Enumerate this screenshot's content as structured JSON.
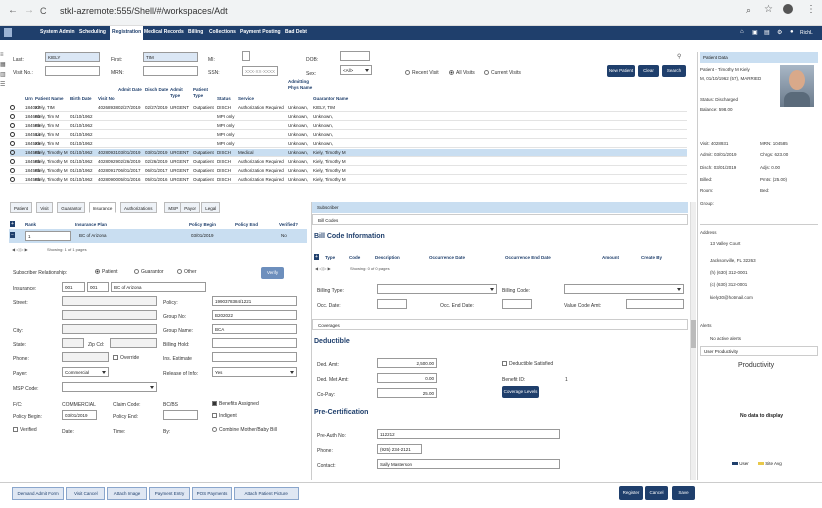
{
  "browser": {
    "url": "stkl-azremote:555/Shell/#/workspaces/Adt",
    "back": "←",
    "forward": "→",
    "reload": "C"
  },
  "nav": {
    "items": [
      "System Admin",
      "Scheduling",
      "Registration",
      "Medical Records",
      "Billing",
      "Collections",
      "Payment Posting",
      "Bad Debt"
    ],
    "active": 2,
    "user": "RichL"
  },
  "search": {
    "last_label": "Last:",
    "last_value": "KIELY",
    "first_label": "First:",
    "first_value": "TIM",
    "mi_label": "MI:",
    "dob_label": "DOB:",
    "visit_label": "Visit No.:",
    "mrn_label": "MRN:",
    "ssn_label": "SSN:",
    "ssn_placeholder": "XXX-XX-XXXX",
    "sex_label": "Sex:",
    "sex_value": "<All>",
    "recent": "Recent Visit",
    "all": "All Visits",
    "current": "Current Visits",
    "new_patient": "New Patient",
    "clear": "Clear",
    "search_btn": "Search"
  },
  "grid": {
    "headers": [
      "Urn",
      "Patient Name",
      "Birth Date",
      "Visit No",
      "Admit Date",
      "Disch Date",
      "Admit Type",
      "Patient Type",
      "Status",
      "Service",
      "Admitting Phys Name",
      "Guarantor Name"
    ],
    "rows": [
      [
        "184027",
        "Kiely, TIM",
        "",
        "40268938",
        "02/27/2019",
        "02/27/2019",
        "URGENT",
        "Outpatient",
        "DISCH",
        "Authorization Required",
        "Unknown,",
        "KIELY, TIM"
      ],
      [
        "184600",
        "Kiely, Tim M",
        "01/10/1962",
        "",
        "",
        "",
        "",
        "",
        "MPI only",
        "",
        "Unknown,",
        "Unknown,"
      ],
      [
        "184509",
        "Kiely, Tim M",
        "01/10/1962",
        "",
        "",
        "",
        "",
        "",
        "MPI only",
        "",
        "Unknown,",
        "Unknown,"
      ],
      [
        "184514",
        "Kiely, Tim M",
        "01/10/1962",
        "",
        "",
        "",
        "",
        "",
        "MPI only",
        "",
        "Unknown,",
        "Unknown,"
      ],
      [
        "184529",
        "Kiely, Tim M",
        "01/10/1962",
        "",
        "",
        "",
        "",
        "",
        "MPI only",
        "",
        "Unknown,",
        "Unknown,"
      ],
      [
        "184505",
        "Kiely, Timothy M",
        "01/10/1962",
        "40280931",
        "03/01/2019",
        "03/01/2019",
        "URGENT",
        "Outpatient",
        "DISCH",
        "Medical",
        "Unknown,",
        "Kiely, Timothy M"
      ],
      [
        "184505",
        "Kiely, Timothy M",
        "01/10/1962",
        "40280929",
        "02/26/2019",
        "02/26/2019",
        "URGENT",
        "Outpatient",
        "DISCH",
        "Authorization Required",
        "Unknown,",
        "Kiely, Timothy M"
      ],
      [
        "184505",
        "Kiely, Timothy M",
        "01/10/1962",
        "40280917",
        "06/01/2017",
        "06/01/2017",
        "URGENT",
        "Outpatient",
        "DISCH",
        "Authorization Required",
        "Unknown,",
        "Kiely, Timothy M"
      ],
      [
        "184505",
        "Kiely, Timothy M",
        "01/10/1962",
        "40280900",
        "05/01/2016",
        "05/01/2016",
        "URGENT",
        "Outpatient",
        "DISCH",
        "Authorization Required",
        "Unknown,",
        "Kiely, Timothy M"
      ]
    ],
    "selected": 5
  },
  "tabs": [
    "Patient",
    "Visit",
    "Guarantor",
    "Insurance",
    "Authorizations",
    "MSP",
    "Payor",
    "Legal"
  ],
  "active_tab": 3,
  "ins": {
    "h_rank": "Rank",
    "h_plan": "Insurance Plan",
    "h_begin": "Policy Begin",
    "h_end": "Policy End",
    "h_verified": "Verified?",
    "rank": "1",
    "plan": "BC of Arizona",
    "begin": "03/01/2019",
    "verified": "No",
    "showing": "Showing: 1 of 1 pages",
    "sub_rel": "Subscriber Relationship:",
    "patient": "Patient",
    "guarantor": "Guarantor",
    "other": "Other",
    "verify": "Verify",
    "insurance_l": "Insurance:",
    "ins_code1": "001",
    "ins_code2": "001",
    "ins_name": "BC of Arizona",
    "street_l": "Street:",
    "policy_l": "Policy:",
    "policy_v": "1990378384/1221",
    "city_l": "City:",
    "group_no_l": "Group No:",
    "group_no_v": "B202022",
    "state_l": "State:",
    "zip_l": "Zip Cd:",
    "group_name_l": "Group Name:",
    "group_name_v": "BCA",
    "phone_l": "Phone:",
    "override": "Override",
    "billing_hold_l": "Billing Hold:",
    "ins_est_l": "Ins. Estimate",
    "payer_l": "Payer:",
    "payer_v": "Commercial",
    "release_l": "Release of Info:",
    "release_v": "Yes",
    "msp_l": "MSP Code:",
    "fc_l": "F/C:",
    "fc_v": "COMMERCIAL",
    "claim_l": "Claim Code:",
    "claim_v": "BC/BS",
    "benefits": "Benefits Assigned",
    "policy_begin_l": "Policy Begin:",
    "policy_begin_v": "03/01/2019",
    "policy_end_l": "Policy End:",
    "indigent": "Indigent",
    "verified_l": "Verified",
    "date_l": "Date:",
    "time_l": "Time:",
    "by_l": "By:",
    "combine": "Combine Mother/Baby Bill"
  },
  "bill": {
    "subscriber": "Subscriber",
    "bill_codes": "Bill Codes",
    "title": "Bill Code Information",
    "h_type": "Type",
    "h_code": "Code",
    "h_desc": "Description",
    "h_occ": "Occurrence Date",
    "h_occ_end": "Occurrence End Date",
    "h_amount": "Amount",
    "h_create": "Create By",
    "showing": "Showing: 0 of 0 pages",
    "billing_type": "Billing Type:",
    "billing_code": "Billing Code:",
    "occ_date": "Occ. Date:",
    "occ_end": "Occ. End Date:",
    "value_code": "Value Code Amt:",
    "coverages": "Coverages",
    "deductible": "Deductible",
    "ded_amt_l": "Ded. Amt:",
    "ded_amt_v": "2,500.00",
    "ded_met_l": "Ded. Met Amt:",
    "ded_met_v": "0.00",
    "copay_l": "Co-Pay:",
    "copay_v": "25.00",
    "ded_sat": "Deductible Satisfied",
    "benefit_id_l": "Benefit ID:",
    "benefit_id_v": "1",
    "coverage_levels": "Coverage Levels",
    "precert": "Pre-Certification",
    "preauth_l": "Pre-Auth No:",
    "preauth_v": "112212",
    "phone_l": "Phone:",
    "phone_v": "(925) 234-2121",
    "contact_l": "Contact:",
    "contact_v": "Sally Masterson"
  },
  "patient_data": {
    "title": "Patient Data",
    "name": "Patient - Timothy M Kiely",
    "line2": "M, 01/10/1962 (57), MARRIED",
    "status": "Status: Discharged",
    "balance": "Balance: 598.00",
    "visit": "Visit: 4028931",
    "mrn": "MRN: 104585",
    "admit": "Admit: 03/01/2019",
    "chrgs": "Chrgs: 623.00",
    "disch": "Disch: 03/01/2019",
    "adjs": "Adjs: 0.00",
    "billed": "Billed:",
    "pmts": "Pmts: (25.00)",
    "room": "Room:",
    "bed": "Bed:",
    "group": "Group:",
    "address_l": "Address",
    "addr1": "13 Valley Court",
    "addr2": "Jacksonville, FL 32263",
    "phone_h": "(630) 312-0001",
    "phone_c": "(630) 312-0001",
    "email": "kiely30@hotmail.com",
    "alerts_l": "Alerts",
    "alerts_v": "No active alerts",
    "user_prod": "User Productivity",
    "productivity": "Productivity",
    "no_data": "No data to display",
    "legend_user": "User",
    "legend_site": "Site Avg"
  },
  "footer": {
    "buttons": [
      "Demand Admit Form",
      "Visit Cancel",
      "Attach Image",
      "Payment Entry",
      "POS Payments",
      "Attach Patient Picture"
    ],
    "register": "Register",
    "cancel": "Cancel",
    "save": "Save"
  },
  "colors": {
    "nav": "#1f3f6c",
    "accent": "#1f3f6c",
    "selected": "#c9def1"
  }
}
